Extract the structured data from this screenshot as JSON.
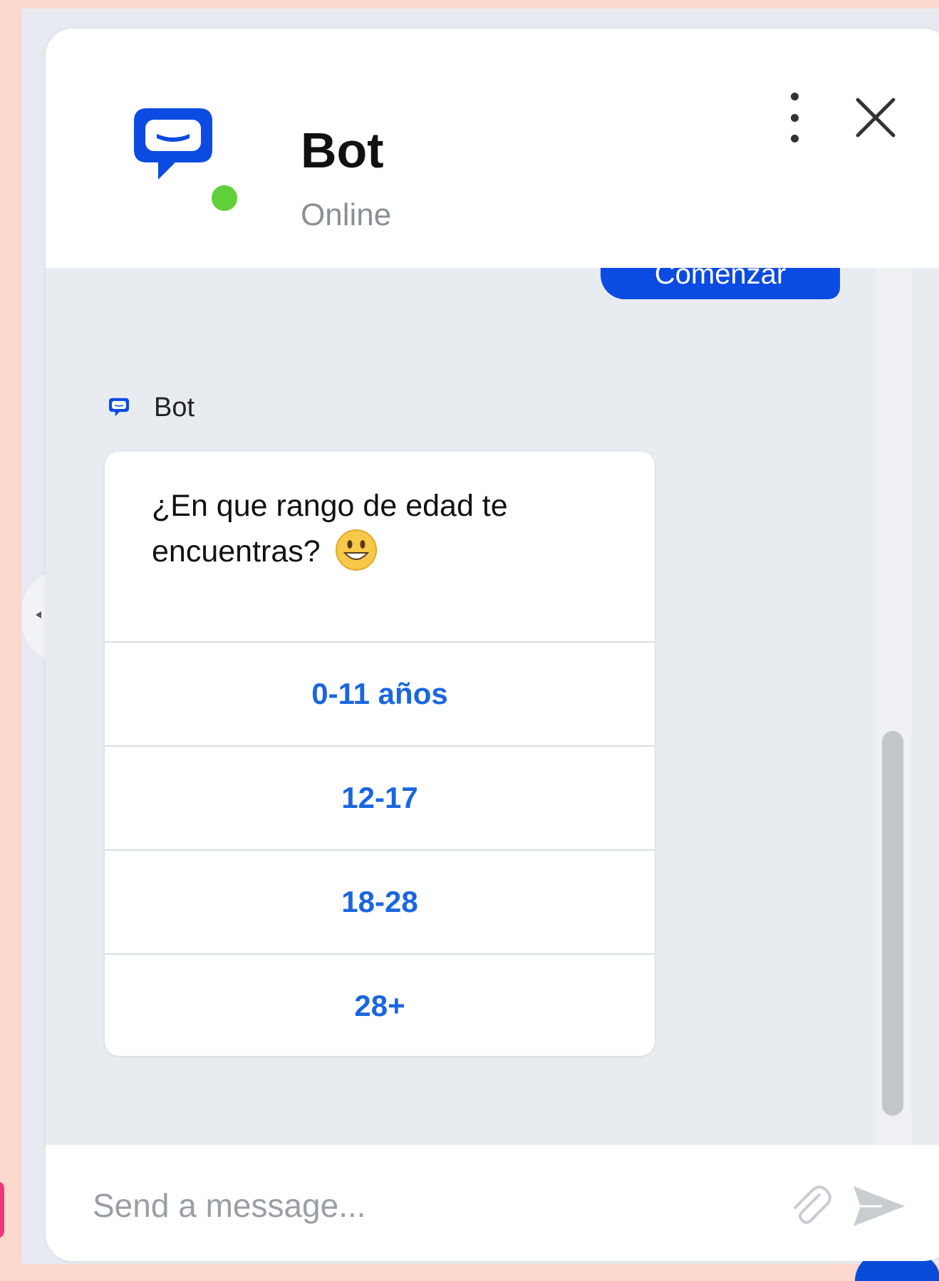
{
  "header": {
    "bot_name": "Bot",
    "status": "Online"
  },
  "conversation": {
    "user_message_partial": "Comenzar",
    "sender_name": "Bot",
    "bot_question": "¿En que rango de edad te encuentras?",
    "options": [
      {
        "label": "0-11 años"
      },
      {
        "label": "12-17"
      },
      {
        "label": "18-28"
      },
      {
        "label": "28+"
      }
    ]
  },
  "composer": {
    "placeholder": "Send a message..."
  },
  "icons": {
    "logo": "chat-bubble-logo-icon",
    "menu": "more-vertical-icon",
    "close": "close-icon",
    "emoji": "grinning-face-emoji-icon",
    "attach": "paperclip-icon",
    "send": "send-icon"
  },
  "colors": {
    "accent": "#0b4be2",
    "option_text": "#1a66e0",
    "online": "#5fd03a",
    "page_background": "#fcd9cc"
  }
}
